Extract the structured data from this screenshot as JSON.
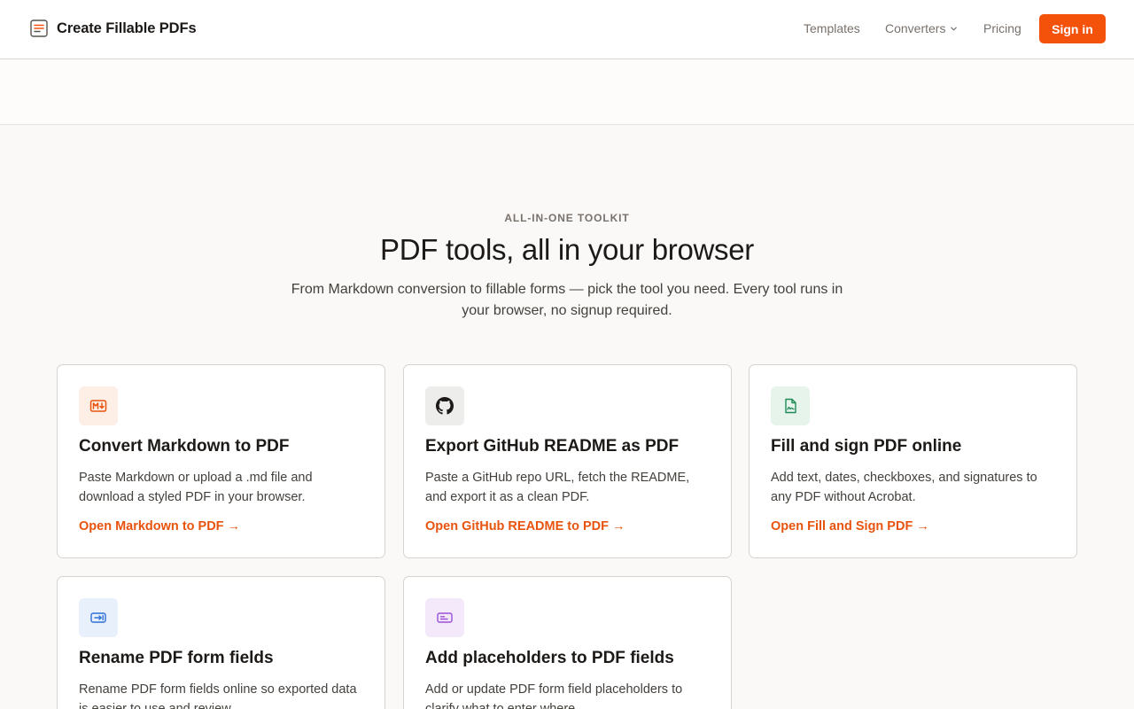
{
  "header": {
    "brand": "Create Fillable PDFs",
    "nav": {
      "templates": "Templates",
      "converters": "Converters",
      "pricing": "Pricing"
    },
    "signin": "Sign in"
  },
  "hero": {
    "eyebrow": "ALL-IN-ONE TOOLKIT",
    "heading": "PDF tools, all in your browser",
    "subtitle": "From Markdown conversion to fillable forms — pick the tool you need. Every tool runs in your browser, no signup required."
  },
  "cards": [
    {
      "icon": "markdown-icon",
      "title": "Convert Markdown to PDF",
      "description": "Paste Markdown or upload a .md file and download a styled PDF in your browser.",
      "link": "Open Markdown to PDF →"
    },
    {
      "icon": "github-icon",
      "title": "Export GitHub README as PDF",
      "description": "Paste a GitHub repo URL, fetch the README, and export it as a clean PDF.",
      "link": "Open GitHub README to PDF →"
    },
    {
      "icon": "signature-file-icon",
      "title": "Fill and sign PDF online",
      "description": "Add text, dates, checkboxes, and signatures to any PDF without Acrobat.",
      "link": "Open Fill and Sign PDF →"
    },
    {
      "icon": "rename-field-icon",
      "title": "Rename PDF form fields",
      "description": "Rename PDF form fields online so exported data is easier to use and review."
    },
    {
      "icon": "placeholder-field-icon",
      "title": "Add placeholders to PDF fields",
      "description": "Add or update PDF form field placeholders to clarify what to enter where."
    }
  ],
  "colors": {
    "accent": "#f4510b",
    "link": "#e8530e",
    "markdown_icon_bg": "#fdeee6",
    "github_icon_bg": "#ededec",
    "sign_icon_bg": "#e6f4ec",
    "rename_icon_bg": "#e8f0fc",
    "placeholder_icon_bg": "#f3e9fb"
  }
}
